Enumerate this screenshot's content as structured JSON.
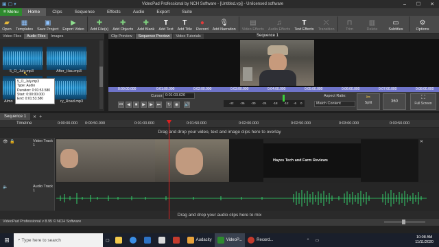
{
  "window": {
    "title": "VideoPad Professional by NCH Software - [Untitled.vpj] - Unlicensed software"
  },
  "ribbon": {
    "menu_label": "Menu",
    "tabs": [
      "Home",
      "Clips",
      "Sequence",
      "Effects",
      "Audio",
      "Export",
      "Suite"
    ]
  },
  "toolbar": {
    "items": [
      {
        "label": "Open",
        "icon": "folder-icon"
      },
      {
        "label": "Templates",
        "icon": "templates-icon"
      },
      {
        "label": "Save Project",
        "icon": "save-icon"
      },
      {
        "label": "Export Video",
        "icon": "export-icon"
      },
      {
        "label": "Add File(s)",
        "icon": "add-file-icon"
      },
      {
        "label": "Add Objects",
        "icon": "add-objects-icon"
      },
      {
        "label": "Add Blank",
        "icon": "add-blank-icon"
      },
      {
        "label": "Add Text",
        "icon": "add-text-icon"
      },
      {
        "label": "Add Title",
        "icon": "add-title-icon"
      },
      {
        "label": "Record",
        "icon": "record-icon"
      },
      {
        "label": "Add Narration",
        "icon": "narration-icon"
      },
      {
        "label": "Video Effects",
        "icon": "video-effects-icon"
      },
      {
        "label": "Audio Effects",
        "icon": "audio-effects-icon"
      },
      {
        "label": "Text Effects",
        "icon": "text-effects-icon"
      },
      {
        "label": "Transition",
        "icon": "transition-icon"
      },
      {
        "label": "Trim",
        "icon": "trim-icon"
      },
      {
        "label": "Delete",
        "icon": "delete-icon"
      },
      {
        "label": "Subtitles",
        "icon": "subtitles-icon"
      },
      {
        "label": "Options",
        "icon": "gear-icon"
      }
    ]
  },
  "media": {
    "tabs": [
      "Video Files",
      "Audio Files",
      "Images"
    ],
    "clips": [
      {
        "name": "5_O_July.mp3"
      },
      {
        "name": "After_Hau.mp3"
      },
      {
        "name": "Almo"
      },
      {
        "name": "ry_Road.mp3"
      }
    ],
    "tooltip": {
      "name": "5_O_July.mp3",
      "type": "Type: Audio",
      "duration": "Duration: 0:01:53.580",
      "start": "Start: 0:00:00.000",
      "end": "End: 0:01:53.580"
    }
  },
  "preview": {
    "tabs": [
      "Clip Preview",
      "Sequence Preview",
      "Video Tutorials"
    ],
    "sequence_title": "Sequence 1",
    "ruler_ticks": [
      "0:00:00.000",
      "0:01:00.000",
      "0:02:00.000",
      "0:03:00.000",
      "0:04:00.000",
      "0:05:00.000",
      "0:06:00.000",
      "0:07:00.000",
      "0:08:00.000"
    ],
    "cursor_label": "Cursor:",
    "cursor_value": "0:01:03.620",
    "meter_ticks": [
      "-42",
      "-36",
      "-30",
      "-24",
      "-18",
      "-12",
      "-6",
      "0"
    ],
    "aspect_label": "Aspect Ratio:",
    "aspect_value": "Match Content",
    "split_label": "Split",
    "view360_label": "360",
    "fullscreen_label": "Full Screen"
  },
  "timeline": {
    "sequence_tab": "Sequence 1",
    "timeline_label": "Timeline",
    "ruler_ticks": [
      "0:00:00.000",
      "0:00:50.000",
      "0:01:00.000",
      "0:01:50.000",
      "0:02:00.000",
      "0:02:50.000",
      "0:03:00.000",
      "0:03:50.000"
    ],
    "overlay_hint": "Drag and drop your video, text and image clips here to overlay",
    "video_track_label": "Video Track 1",
    "audio_track_label": "Audio Track 1",
    "audio_hint": "Drag and drop your audio clips here to mix",
    "title_card_text": "Hayes Tech and Farm Reviews"
  },
  "status": {
    "text": "VideoPad Professional v 8.95 © NCH Software"
  },
  "taskbar": {
    "search_placeholder": "Type here to search",
    "apps": [
      "Audacity",
      "VideoP...",
      "Record..."
    ],
    "time": "10:08 AM",
    "date": "11/11/2020"
  }
}
